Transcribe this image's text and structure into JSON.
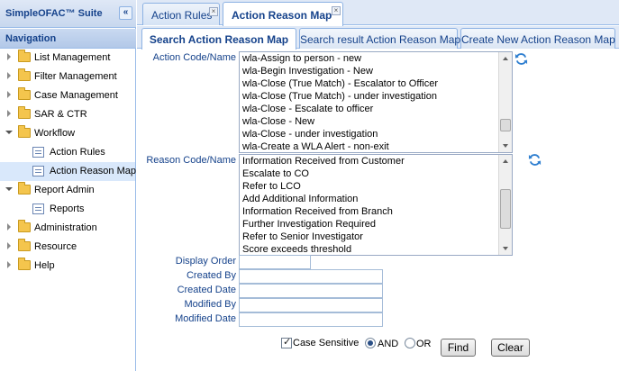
{
  "app": {
    "title": "SimpleOFAC™ Suite",
    "collapse_glyph": "«"
  },
  "navigation": {
    "title": "Navigation",
    "items": [
      {
        "label": "List Management",
        "icon": "folder-icon",
        "expanded": false
      },
      {
        "label": "Filter Management",
        "icon": "folder-icon",
        "expanded": false
      },
      {
        "label": "Case Management",
        "icon": "folder-icon",
        "expanded": false
      },
      {
        "label": "SAR & CTR",
        "icon": "folder-icon",
        "expanded": false
      },
      {
        "label": "Workflow",
        "icon": "folder-icon",
        "expanded": true,
        "children": [
          {
            "label": "Action Rules",
            "icon": "page-icon"
          },
          {
            "label": "Action Reason Map",
            "icon": "page-icon",
            "selected": true
          }
        ]
      },
      {
        "label": "Report Admin",
        "icon": "folder-icon",
        "expanded": true,
        "children": [
          {
            "label": "Reports",
            "icon": "page-icon"
          }
        ]
      },
      {
        "label": "Administration",
        "icon": "folder-icon",
        "expanded": false
      },
      {
        "label": "Resource",
        "icon": "folder-icon",
        "expanded": false
      },
      {
        "label": "Help",
        "icon": "folder-icon",
        "expanded": false
      }
    ]
  },
  "tabs": [
    {
      "label": "Action Rules",
      "active": false
    },
    {
      "label": "Action Reason Map",
      "active": true
    }
  ],
  "subtabs": [
    {
      "label": "Search Action Reason Map",
      "active": true
    },
    {
      "label": "Search result Action Reason Map",
      "active": false
    },
    {
      "label": "Create New Action Reason Map",
      "active": false
    }
  ],
  "form": {
    "action_code_label": "Action Code/Name",
    "action_codes": [
      "wla-Assign to person - new",
      "wla-Begin Investigation - New",
      "wla-Close (True Match) - Escalator to Officer",
      "wla-Close (True Match) - under investigation",
      "wla-Close - Escalate to officer",
      "wla-Close - New",
      "wla-Close - under investigation",
      "wla-Create a WLA Alert - non-exit"
    ],
    "reason_code_label": "Reason Code/Name",
    "reason_codes": [
      "Information Received from Customer",
      "Escalate to CO",
      "Refer to LCO",
      "Add Additional Information",
      "Information Received from Branch",
      "Further Investigation Required",
      "Refer to Senior Investigator",
      "Score exceeds threshold"
    ],
    "display_order_label": "Display Order",
    "created_by_label": "Created By",
    "created_date_label": "Created Date",
    "modified_by_label": "Modified By",
    "modified_date_label": "Modified Date",
    "display_order_value": "",
    "created_by_value": "",
    "created_date_value": "",
    "modified_by_value": "",
    "modified_date_value": ""
  },
  "search_options": {
    "case_sensitive_label": "Case Sensitive",
    "case_sensitive_checked": true,
    "and_label": "AND",
    "or_label": "OR",
    "selected_operator": "AND",
    "find_label": "Find",
    "clear_label": "Clear"
  },
  "colors": {
    "accent": "#15428b",
    "border": "#99bbe8",
    "header_bg": "#dfe8f6"
  }
}
